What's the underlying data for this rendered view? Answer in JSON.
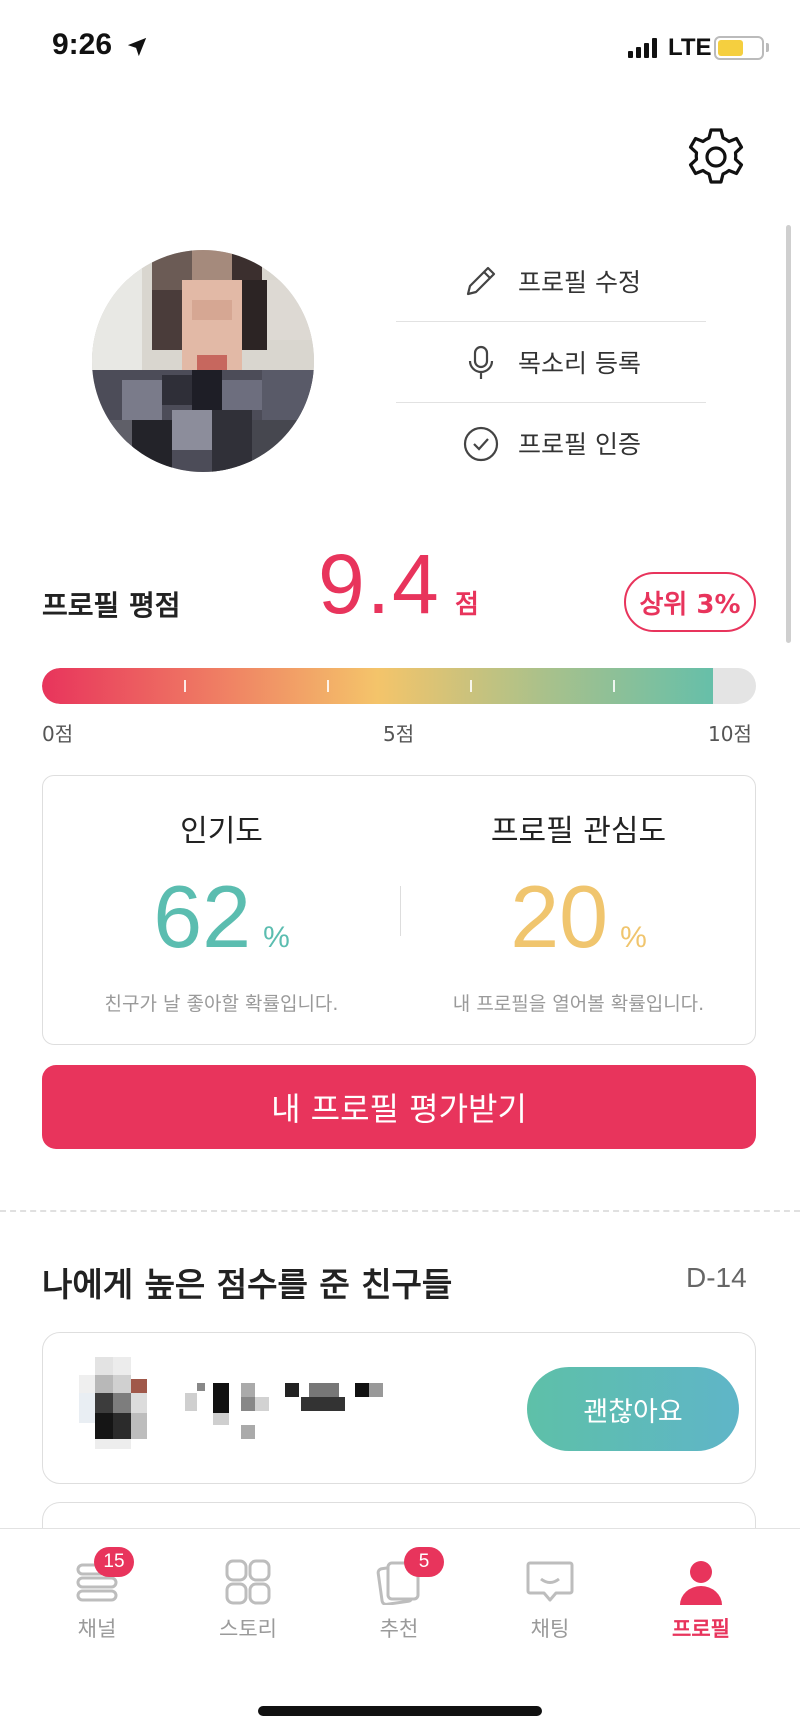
{
  "status_bar": {
    "time": "9:26",
    "network": "LTE"
  },
  "profile_menu": {
    "items": [
      {
        "label": "프로필 수정",
        "icon": "pencil-icon"
      },
      {
        "label": "목소리 등록",
        "icon": "microphone-icon"
      },
      {
        "label": "프로필 인증",
        "icon": "check-circle-icon"
      }
    ]
  },
  "rating": {
    "label": "프로필 평점",
    "score": "9.4",
    "unit": "점",
    "rank": "상위 3%",
    "gauge_value": 9.4,
    "gauge_max": 10,
    "scale": {
      "min": "0점",
      "mid": "5점",
      "max": "10점"
    }
  },
  "stats": {
    "popularity": {
      "title": "인기도",
      "value": "62",
      "unit": "%",
      "desc": "친구가 날 좋아할 확률입니다."
    },
    "interest": {
      "title": "프로필 관심도",
      "value": "20",
      "unit": "%",
      "desc": "내 프로필을 열어볼 확률입니다."
    }
  },
  "cta": {
    "label": "내 프로필 평가받기"
  },
  "friends_section": {
    "title": "나에게 높은 점수를 준 친구들",
    "dday": "D-14",
    "action_label": "괜찮아요"
  },
  "tabs": [
    {
      "label": "채널",
      "badge": "15",
      "icon": "channel-list-icon"
    },
    {
      "label": "스토리",
      "badge": "",
      "icon": "story-grid-icon"
    },
    {
      "label": "추천",
      "badge": "5",
      "icon": "recommend-cards-icon"
    },
    {
      "label": "채팅",
      "badge": "",
      "icon": "chat-bubble-icon"
    },
    {
      "label": "프로필",
      "badge": "",
      "icon": "person-icon",
      "active": true
    }
  ],
  "colors": {
    "accent": "#e8345c",
    "popularity": "#5bbdb0",
    "interest": "#f0c56e",
    "action_gradient_start": "#5ec0a8",
    "action_gradient_end": "#5fb5c8"
  }
}
